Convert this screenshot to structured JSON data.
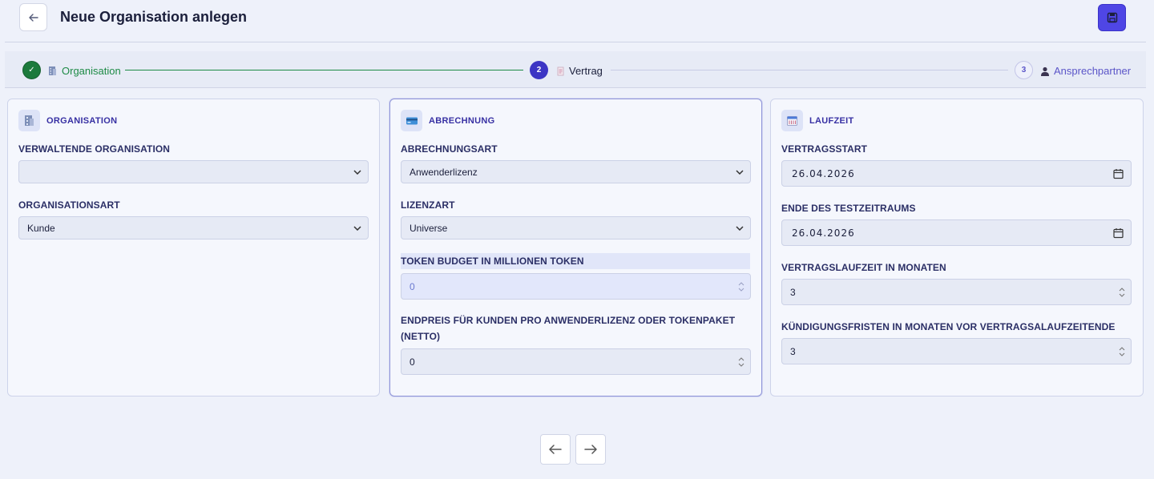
{
  "header": {
    "title": "Neue Organisation anlegen"
  },
  "stepper": {
    "steps": [
      {
        "number": "✓",
        "label": "Organisation",
        "status": "done"
      },
      {
        "number": "2",
        "label": "Vertrag",
        "status": "active"
      },
      {
        "number": "3",
        "label": "Ansprechpartner",
        "status": "pending"
      }
    ]
  },
  "cards": {
    "organisation": {
      "title": "ORGANISATION",
      "fields": {
        "verwaltende_label": "VERWALTENDE ORGANISATION",
        "verwaltende_value": "",
        "art_label": "ORGANISATIONSART",
        "art_value": "Kunde"
      }
    },
    "abrechnung": {
      "title": "ABRECHNUNG",
      "fields": {
        "abrechnungsart_label": "ABRECHNUNGSART",
        "abrechnungsart_value": "Anwenderlizenz",
        "lizenzart_label": "LIZENZART",
        "lizenzart_value": "Universe",
        "token_label": "TOKEN BUDGET IN MILLIONEN TOKEN",
        "token_value": "0",
        "endpreis_label_line1": "ENDPREIS FÜR KUNDEN PRO ANWENDERLIZENZ ODER TOKENPAKET",
        "endpreis_label_line2": "(NETTO)",
        "endpreis_value": "0"
      }
    },
    "laufzeit": {
      "title": "LAUFZEIT",
      "fields": {
        "vertragsstart_label": "VERTRAGSSTART",
        "vertragsstart_value": "26.04.2026",
        "testende_label": "ENDE DES TESTZEITRAUMS",
        "testende_value": "26.04.2026",
        "laufzeit_label": "VERTRAGSLAUFZEIT IN MONATEN",
        "laufzeit_value": "3",
        "kuendigung_label": "KÜNDIGUNGSFRISTEN IN MONATEN VOR VERTRAGSALAUFZEITENDE",
        "kuendigung_value": "3"
      }
    }
  },
  "icons": {
    "back": "arrow-left-icon",
    "save": "floppy-disk-icon",
    "organisation": "building-icon",
    "abrechnung": "credit-card-icon",
    "laufzeit": "calendar-icon",
    "ansprechpartner": "person-icon",
    "vertrag": "document-icon",
    "nav_prev": "arrow-left-icon",
    "nav_next": "arrow-right-icon"
  },
  "colors": {
    "accent": "#4f46e5",
    "done": "#1d8a45",
    "title": "#3730a3"
  }
}
